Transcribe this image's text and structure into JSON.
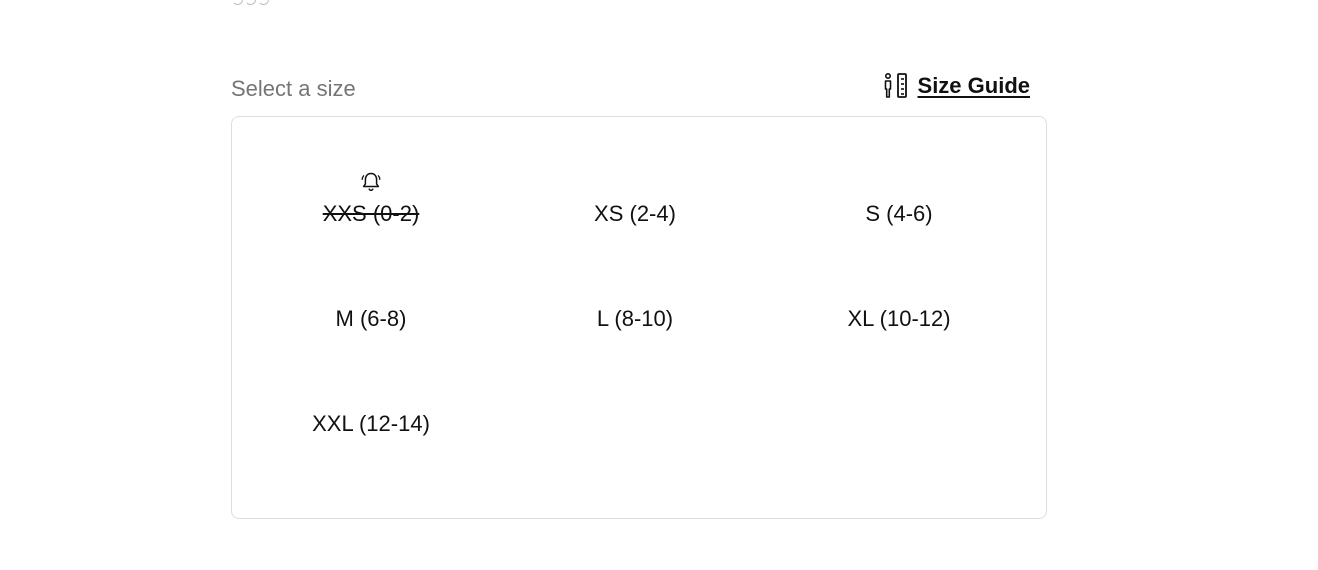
{
  "header": {
    "select_label": "Select a size",
    "size_guide_label": "Size Guide",
    "size_guide_icon": "body-measure-icon"
  },
  "sizes": [
    {
      "label": "XXS (0-2)",
      "available": false,
      "notify_icon": "bell-notify-icon"
    },
    {
      "label": "XS (2-4)",
      "available": true
    },
    {
      "label": "S (4-6)",
      "available": true
    },
    {
      "label": "M (6-8)",
      "available": true
    },
    {
      "label": "L (8-10)",
      "available": true
    },
    {
      "label": "XL (10-12)",
      "available": true
    },
    {
      "label": "XXL (12-14)",
      "available": true
    }
  ],
  "colors": {
    "text": "#111111",
    "label_muted": "#757575",
    "border": "#dedede"
  }
}
